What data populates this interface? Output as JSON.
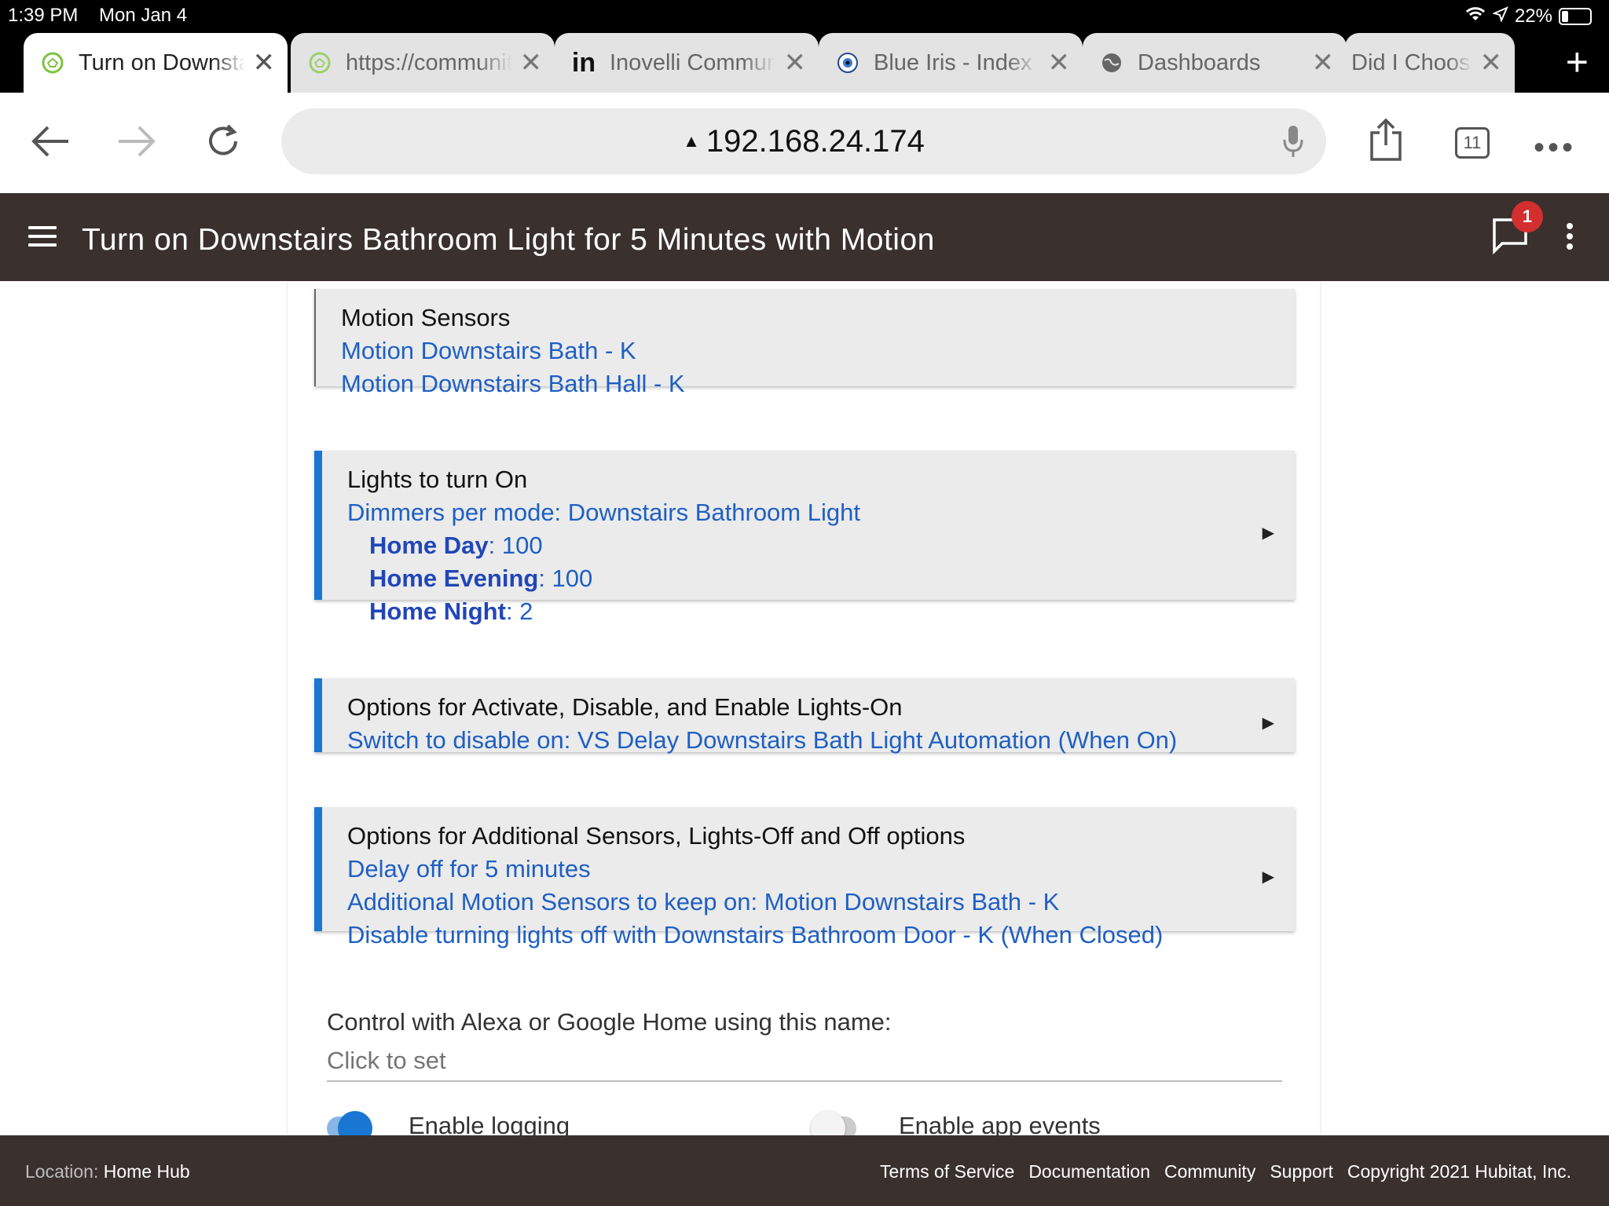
{
  "status_bar": {
    "time": "1:39 PM",
    "date": "Mon Jan 4",
    "battery": "22%"
  },
  "tabs": [
    {
      "title": "Turn on Downstairs",
      "active": true
    },
    {
      "title": "https://community",
      "active": false
    },
    {
      "title": "Inovelli Community",
      "active": false
    },
    {
      "title": "Blue Iris - Index",
      "active": false
    },
    {
      "title": "Dashboards",
      "active": false
    },
    {
      "title": "Did I Choose",
      "active": false
    }
  ],
  "toolbar": {
    "url": "192.168.24.174",
    "tab_count": "11"
  },
  "header": {
    "title": "Turn on Downstairs Bathroom Light for 5 Minutes with Motion",
    "notification_count": "1"
  },
  "cards": {
    "motion": {
      "heading": "Motion Sensors",
      "items": [
        "Motion Downstairs Bath - K",
        "Motion Downstairs Bath Hall - K"
      ]
    },
    "lights": {
      "heading": "Lights to turn On",
      "link": "Dimmers per mode: Downstairs Bathroom Light",
      "modes": [
        {
          "name": "Home Day",
          "value": ": 100"
        },
        {
          "name": "Home Evening",
          "value": ": 100"
        },
        {
          "name": "Home Night",
          "value": ": 2"
        }
      ]
    },
    "activate": {
      "heading": "Options for Activate, Disable, and Enable Lights-On",
      "items": [
        "Switch to disable on: VS Delay Downstairs Bath Light Automation (When On)"
      ]
    },
    "additional": {
      "heading": "Options for Additional Sensors, Lights-Off and Off options",
      "items": [
        "Delay off for 5 minutes",
        "Additional Motion Sensors to keep on: Motion Downstairs Bath - K",
        "Disable turning lights off with Downstairs Bathroom Door - K (When Closed)"
      ]
    }
  },
  "alexa": {
    "label": "Control with Alexa or Google Home using this name:",
    "placeholder": "Click to set"
  },
  "toggles": {
    "logging_label": "Enable logging",
    "logging_on": true,
    "events_label": "Enable app events",
    "events_on": false
  },
  "footer": {
    "location_key": "Location:",
    "location_value": "Home Hub",
    "links": [
      "Terms of Service",
      "Documentation",
      "Community",
      "Support",
      "Copyright 2021 Hubitat, Inc."
    ]
  },
  "colors": {
    "accent": "#1976d2",
    "header_bg": "#3a302e",
    "link": "#1f5fc4"
  }
}
